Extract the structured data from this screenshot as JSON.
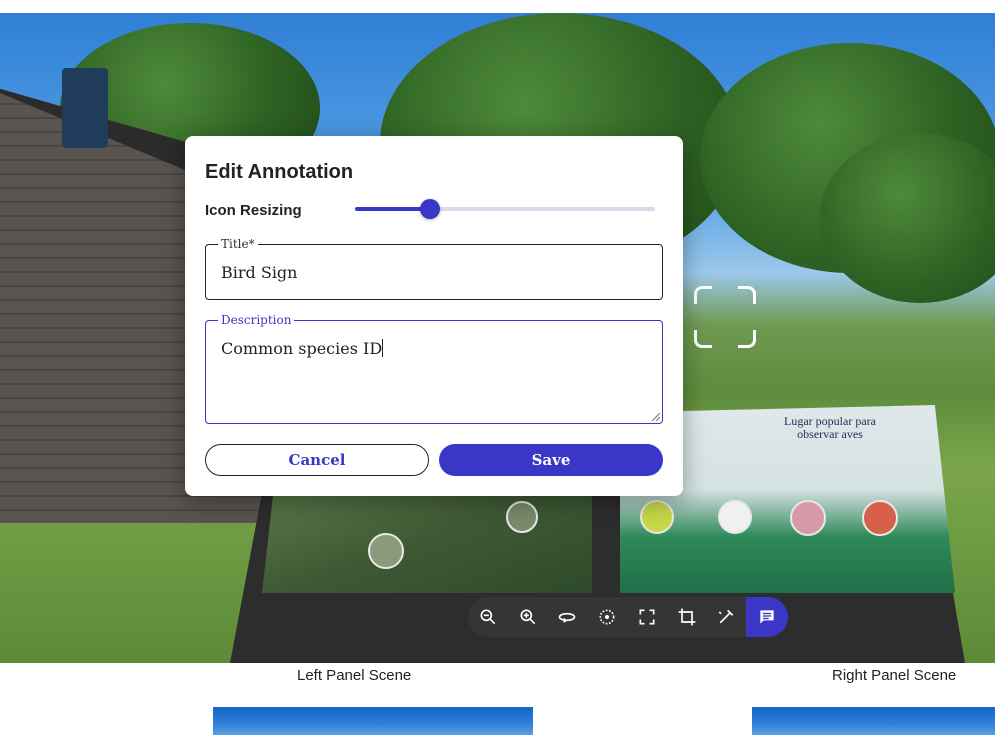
{
  "dialog": {
    "title": "Edit Annotation",
    "resize_label": "Icon Resizing",
    "slider_fraction": 0.25,
    "title_field": {
      "label": "Title*",
      "value": "Bird Sign"
    },
    "description_field": {
      "label": "Description",
      "value": "Common species ID"
    },
    "cancel_label": "Cancel",
    "save_label": "Save"
  },
  "scene": {
    "sign_heading": "Lugar popular para observar aves"
  },
  "toolbar": {
    "tools": [
      "zoom-out-icon",
      "zoom-in-icon",
      "rotate-icon",
      "compass-icon",
      "fullscreen-icon",
      "crop-icon",
      "edit-icon",
      "comment-icon"
    ],
    "active_tool": "comment-icon"
  },
  "scenes": {
    "left_label": "Left Panel Scene",
    "right_label": "Right Panel Scene"
  },
  "colors": {
    "accent": "#3a36c8"
  }
}
